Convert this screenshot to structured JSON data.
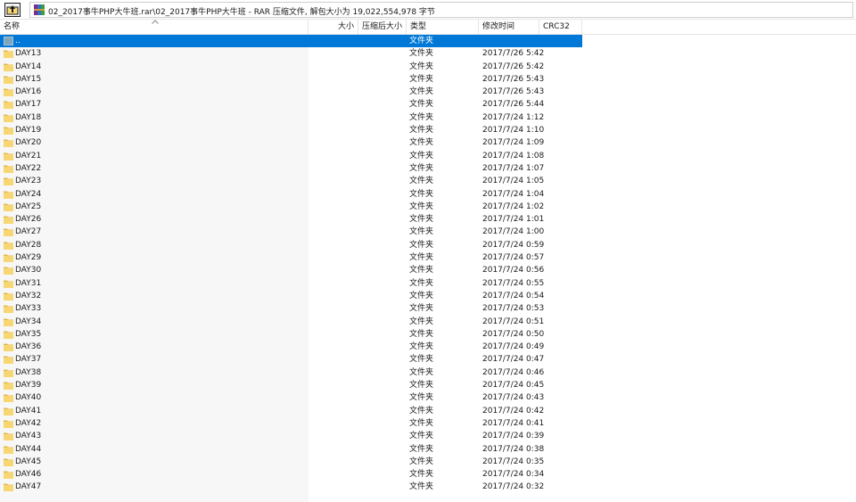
{
  "window": {
    "path": "02_2017事牛PHP大牛班.rar\\02_2017事牛PHP大牛班 - RAR 压缩文件, 解包大小为 19,022,554,978 字节"
  },
  "columns": {
    "name": "名称",
    "size": "大小",
    "packed": "压缩后大小",
    "type": "类型",
    "modified": "修改时间",
    "crc": "CRC32"
  },
  "parent_row": {
    "name": "..",
    "type": "文件夹"
  },
  "rows": [
    {
      "name": "DAY13",
      "type": "文件夹",
      "modified": "2017/7/26 5:42"
    },
    {
      "name": "DAY14",
      "type": "文件夹",
      "modified": "2017/7/26 5:42"
    },
    {
      "name": "DAY15",
      "type": "文件夹",
      "modified": "2017/7/26 5:43"
    },
    {
      "name": "DAY16",
      "type": "文件夹",
      "modified": "2017/7/26 5:43"
    },
    {
      "name": "DAY17",
      "type": "文件夹",
      "modified": "2017/7/26 5:44"
    },
    {
      "name": "DAY18",
      "type": "文件夹",
      "modified": "2017/7/24 1:12"
    },
    {
      "name": "DAY19",
      "type": "文件夹",
      "modified": "2017/7/24 1:10"
    },
    {
      "name": "DAY20",
      "type": "文件夹",
      "modified": "2017/7/24 1:09"
    },
    {
      "name": "DAY21",
      "type": "文件夹",
      "modified": "2017/7/24 1:08"
    },
    {
      "name": "DAY22",
      "type": "文件夹",
      "modified": "2017/7/24 1:07"
    },
    {
      "name": "DAY23",
      "type": "文件夹",
      "modified": "2017/7/24 1:05"
    },
    {
      "name": "DAY24",
      "type": "文件夹",
      "modified": "2017/7/24 1:04"
    },
    {
      "name": "DAY25",
      "type": "文件夹",
      "modified": "2017/7/24 1:02"
    },
    {
      "name": "DAY26",
      "type": "文件夹",
      "modified": "2017/7/24 1:01"
    },
    {
      "name": "DAY27",
      "type": "文件夹",
      "modified": "2017/7/24 1:00"
    },
    {
      "name": "DAY28",
      "type": "文件夹",
      "modified": "2017/7/24 0:59"
    },
    {
      "name": "DAY29",
      "type": "文件夹",
      "modified": "2017/7/24 0:57"
    },
    {
      "name": "DAY30",
      "type": "文件夹",
      "modified": "2017/7/24 0:56"
    },
    {
      "name": "DAY31",
      "type": "文件夹",
      "modified": "2017/7/24 0:55"
    },
    {
      "name": "DAY32",
      "type": "文件夹",
      "modified": "2017/7/24 0:54"
    },
    {
      "name": "DAY33",
      "type": "文件夹",
      "modified": "2017/7/24 0:53"
    },
    {
      "name": "DAY34",
      "type": "文件夹",
      "modified": "2017/7/24 0:51"
    },
    {
      "name": "DAY35",
      "type": "文件夹",
      "modified": "2017/7/24 0:50"
    },
    {
      "name": "DAY36",
      "type": "文件夹",
      "modified": "2017/7/24 0:49"
    },
    {
      "name": "DAY37",
      "type": "文件夹",
      "modified": "2017/7/24 0:47"
    },
    {
      "name": "DAY38",
      "type": "文件夹",
      "modified": "2017/7/24 0:46"
    },
    {
      "name": "DAY39",
      "type": "文件夹",
      "modified": "2017/7/24 0:45"
    },
    {
      "name": "DAY40",
      "type": "文件夹",
      "modified": "2017/7/24 0:43"
    },
    {
      "name": "DAY41",
      "type": "文件夹",
      "modified": "2017/7/24 0:42"
    },
    {
      "name": "DAY42",
      "type": "文件夹",
      "modified": "2017/7/24 0:41"
    },
    {
      "name": "DAY43",
      "type": "文件夹",
      "modified": "2017/7/24 0:39"
    },
    {
      "name": "DAY44",
      "type": "文件夹",
      "modified": "2017/7/24 0:38"
    },
    {
      "name": "DAY45",
      "type": "文件夹",
      "modified": "2017/7/24 0:35"
    },
    {
      "name": "DAY46",
      "type": "文件夹",
      "modified": "2017/7/24 0:34"
    },
    {
      "name": "DAY47",
      "type": "文件夹",
      "modified": "2017/7/24 0:32"
    }
  ],
  "colors": {
    "selection": "#0078d7",
    "folder": "#f7d774",
    "folder_dark": "#e4b94a"
  },
  "icons": {
    "up": "up-folder-icon",
    "archive": "rar-archive-icon",
    "folder": "folder-icon",
    "sort": "sort-ascending-icon"
  }
}
